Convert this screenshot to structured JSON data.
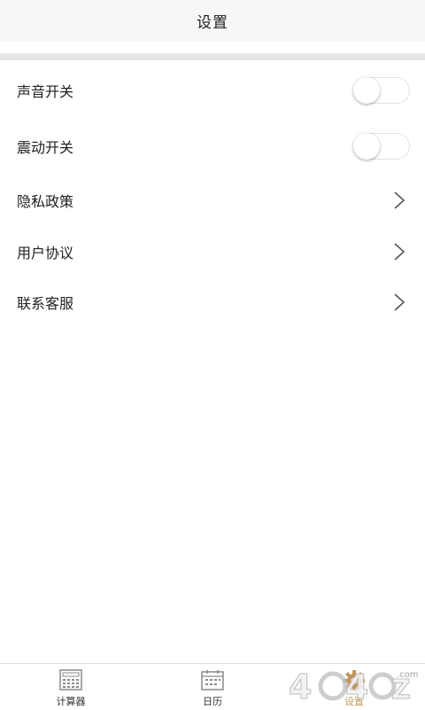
{
  "header": {
    "title": "设置"
  },
  "settings": {
    "sound": {
      "label": "声音开关",
      "on": false
    },
    "vibration": {
      "label": "震动开关",
      "on": false
    },
    "privacy": {
      "label": "隐私政策"
    },
    "agreement": {
      "label": "用户协议"
    },
    "support": {
      "label": "联系客服"
    }
  },
  "tabbar": {
    "tabs": [
      {
        "label": "计算器",
        "icon": "calculator-icon",
        "active": false
      },
      {
        "label": "日历",
        "icon": "calendar-icon",
        "active": false
      },
      {
        "label": "设置",
        "icon": "gear-icon",
        "active": true
      }
    ]
  },
  "watermark": {
    "text": "4○4○Z",
    "suffix": ".com"
  },
  "colors": {
    "active_tab": "#c1955a",
    "divider": "#e6e6e6"
  }
}
